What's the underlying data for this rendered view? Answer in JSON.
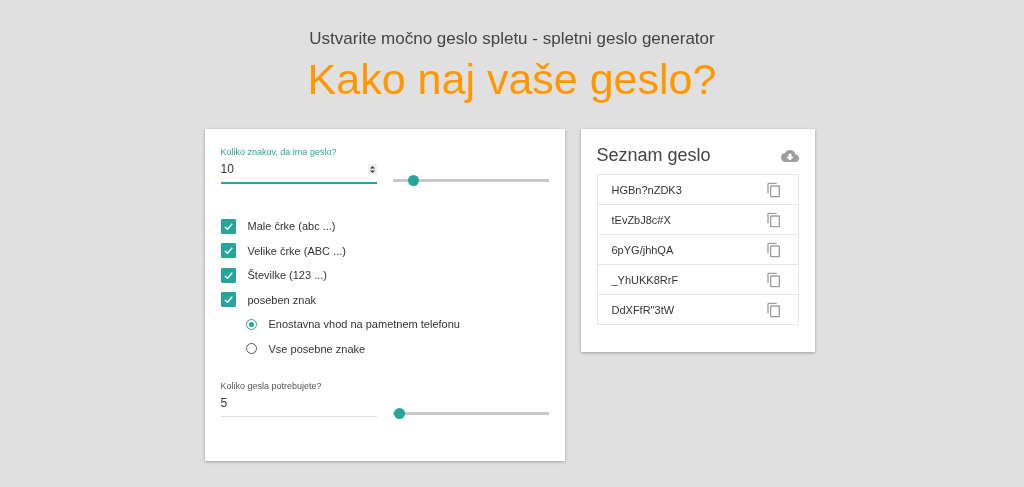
{
  "header": {
    "subtitle": "Ustvarite močno geslo spletu - spletni geslo generator",
    "title": "Kako naj vaše geslo?"
  },
  "settings": {
    "length": {
      "label": "Koliko znakov, da ima geslo?",
      "value": "10",
      "level": 0.13,
      "focused": true
    },
    "options": [
      {
        "label": "Male črke (abc ...)",
        "checked": true
      },
      {
        "label": "Velike črke (ABC ...)",
        "checked": true
      },
      {
        "label": "Številke (123 ...)",
        "checked": true
      },
      {
        "label": "poseben znak",
        "checked": true
      }
    ],
    "special_options": [
      {
        "label": "Enostavna vhod na pametnem telefonu",
        "selected": true
      },
      {
        "label": "Vse posebne znake",
        "selected": false
      }
    ],
    "count": {
      "label": "Koliko gesla potrebujete?",
      "value": "5",
      "level": 0.04,
      "focused": false
    }
  },
  "password_list": {
    "title": "Seznam geslo",
    "items": [
      "HGBn?nZDK3",
      "tEvZbJ8c#X",
      "6pYG/jhhQA",
      "_YhUKK8RrF",
      "DdXFfR\"3tW"
    ]
  }
}
